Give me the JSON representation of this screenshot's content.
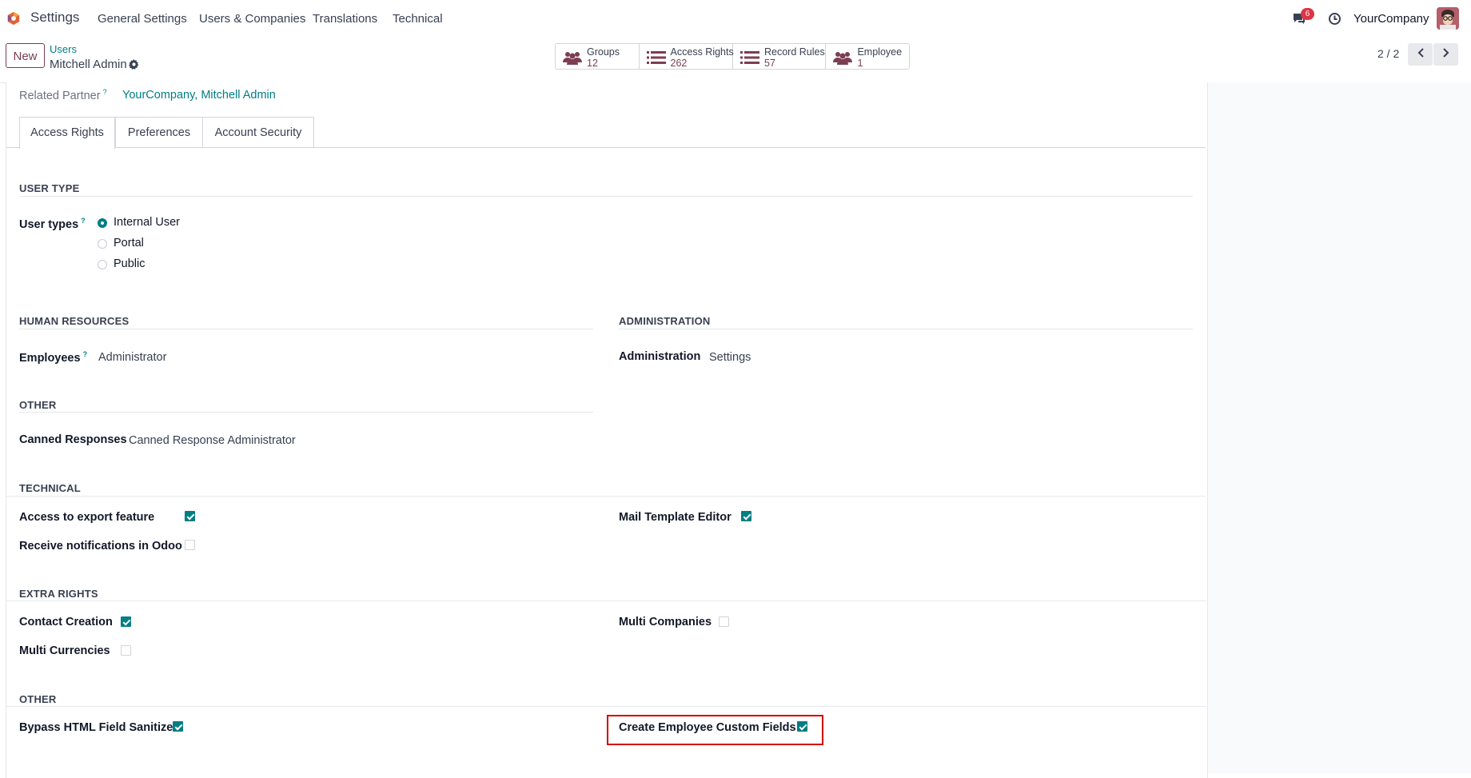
{
  "navbar": {
    "app_name": "Settings",
    "menu": [
      "General Settings",
      "Users & Companies",
      "Translations",
      "Technical"
    ],
    "message_count": "6",
    "company": "YourCompany"
  },
  "control": {
    "new_label": "New",
    "breadcrumb": "Users",
    "record_name": "Mitchell Admin",
    "stats": [
      {
        "label": "Groups",
        "value": "12",
        "icon": "users-icon"
      },
      {
        "label": "Access Rights",
        "value": "262",
        "icon": "list-icon"
      },
      {
        "label": "Record Rules",
        "value": "57",
        "icon": "list-icon"
      },
      {
        "label": "Employee",
        "value": "1",
        "icon": "users-icon"
      }
    ],
    "pager": "2 / 2"
  },
  "form": {
    "related_partner_label": "Related Partner",
    "related_partner_value": "YourCompany, Mitchell Admin",
    "help_mark": "?",
    "tabs": [
      "Access Rights",
      "Preferences",
      "Account Security"
    ],
    "user_type": {
      "title": "USER TYPE",
      "label": "User types",
      "options": [
        "Internal User",
        "Portal",
        "Public"
      ],
      "selected": "Internal User"
    },
    "human_resources": {
      "title": "HUMAN RESOURCES",
      "label": "Employees",
      "value": "Administrator"
    },
    "administration": {
      "title": "ADMINISTRATION",
      "label": "Administration",
      "value": "Settings"
    },
    "other1": {
      "title": "OTHER",
      "label": "Canned Responses",
      "value": "Canned Response Administrator"
    },
    "technical": {
      "title": "TECHNICAL",
      "items": [
        {
          "label": "Access to export feature",
          "checked": true
        },
        {
          "label": "Receive notifications in Odoo",
          "checked": false
        },
        {
          "label": "Mail Template Editor",
          "checked": true
        }
      ]
    },
    "extra_rights": {
      "title": "EXTRA RIGHTS",
      "items": [
        {
          "label": "Contact Creation",
          "checked": true
        },
        {
          "label": "Multi Currencies",
          "checked": false
        },
        {
          "label": "Multi Companies",
          "checked": false
        }
      ]
    },
    "other2": {
      "title": "OTHER",
      "items": [
        {
          "label": "Bypass HTML Field Sanitize",
          "checked": true
        },
        {
          "label": "Create Employee Custom Fields",
          "checked": true
        }
      ]
    }
  },
  "colors": {
    "accent": "#017e84",
    "brand": "#7c3e52",
    "highlight": "#d10000"
  }
}
